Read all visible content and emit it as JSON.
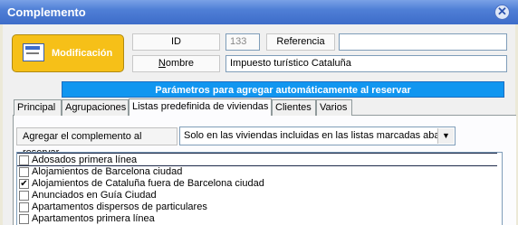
{
  "window": {
    "title": "Complemento",
    "close_glyph": "✕"
  },
  "header": {
    "mode_button_label": "Modificación",
    "id_label": "ID",
    "id_value": "133",
    "referencia_label": "Referencia",
    "referencia_value": "",
    "nombre_label_first": "N",
    "nombre_label_rest": "ombre",
    "nombre_value": "Impuesto turístico Cataluña"
  },
  "banner": {
    "text": "Parámetros para agregar automáticamente al reservar"
  },
  "tabs": [
    {
      "label": "Principal"
    },
    {
      "label": "Agrupaciones"
    },
    {
      "label": "Listas predefinida de viviendas"
    },
    {
      "label": "Clientes"
    },
    {
      "label": "Varios"
    }
  ],
  "agregar": {
    "label": "Agregar el complemento al reservar",
    "selected": "Solo en las viviendas incluidas en las listas marcadas abajo"
  },
  "list": {
    "items": [
      {
        "label": "Adosados primera línea",
        "checked": false
      },
      {
        "label": "Alojamientos de Barcelona ciudad",
        "checked": false
      },
      {
        "label": "Alojamientos de Cataluña fuera de Barcelona ciudad",
        "checked": true
      },
      {
        "label": "Anunciados en Guía Ciudad",
        "checked": false
      },
      {
        "label": "Apartamentos dispersos de particulares",
        "checked": false
      },
      {
        "label": "Apartamentos primera línea",
        "checked": false
      }
    ]
  },
  "icons": {
    "mode": "edit-form-icon",
    "close": "close-icon",
    "dropdown": "chevron-down-icon"
  }
}
